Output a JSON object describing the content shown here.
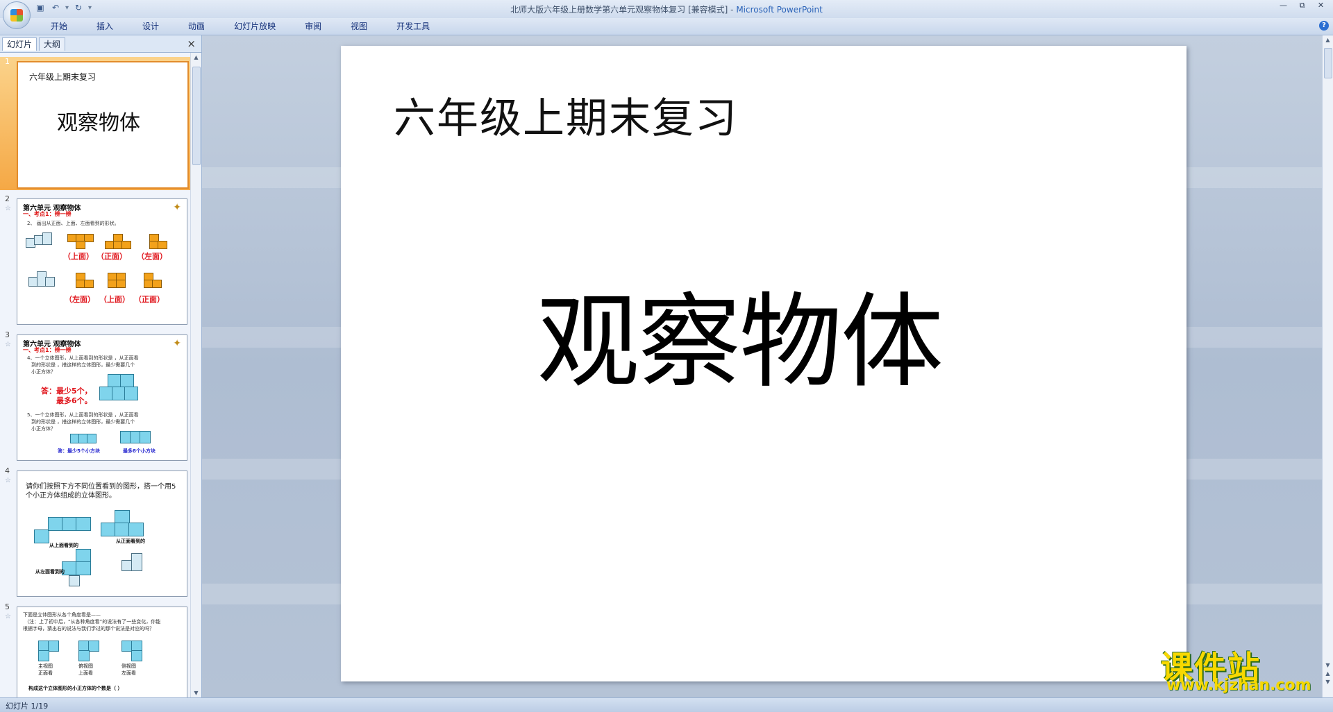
{
  "window": {
    "title_prefix": "北师大版六年级上册数学第六单元观察物体复习 [兼容模式] - ",
    "app_name": "Microsoft PowerPoint"
  },
  "ribbon": {
    "tabs": [
      "开始",
      "插入",
      "设计",
      "动画",
      "幻灯片放映",
      "审阅",
      "视图",
      "开发工具"
    ]
  },
  "panel": {
    "tab_slides": "幻灯片",
    "tab_outline": "大纲",
    "close": "×"
  },
  "thumbnails": [
    {
      "number": "1",
      "subtitle": "六年级上期末复习",
      "title": "观察物体"
    },
    {
      "number": "2",
      "title": "第六单元 观察物体",
      "sub": "一、考点1：辨一辨",
      "line": "2、 画出从正面、上面、左面看到的形状。",
      "labels": [
        "（上面）",
        "（正面）",
        "（左面）",
        "（左面）",
        "（上面）",
        "（正面）"
      ]
    },
    {
      "number": "3",
      "title": "第六单元 观察物体",
      "sub": "一、考点1：辨一辨",
      "line1": "4、一个立体图形，从上面看到的形状是    ，从正面看",
      "line2": "到的形状是    ，搭这样的立体图形，最少需要几个",
      "line3": "小正方体？",
      "answer1": "答：最少5个，",
      "answer2": "最多6个。",
      "line4": "5、一个立体图形，从上面看到的形状是        ，从正面看",
      "line5": "到的形状是    ，搭这样的立体图形，最少需要几个",
      "line6": "小正方体？",
      "cap_left": "答：最少5个小方块",
      "cap_right": "最多8个小方块"
    },
    {
      "number": "4",
      "text": "请你们按照下方不同位置看到的图形，搭一个用5个小正方体组成的立体图形。",
      "cap1": "从上面看到的",
      "cap2": "从正面看到的",
      "cap3": "从左面看到的"
    },
    {
      "number": "5",
      "line1": "下面是立体图形从各个角度看是——",
      "line2": "（注：上了初中后，“从各种角度看”的说法有了一些变化，你能",
      "line3": "根据字母，猜出右的说法与我们学过的那个说法是对应的吗？",
      "cap1": "主视图\n正面看",
      "cap2": "俯视图\n上面看",
      "cap3": "侧视图\n左面看",
      "question": "构成这个立体图形的小正方体的个数是（      ）"
    }
  ],
  "slide": {
    "subtitle": "六年级上期末复习",
    "title": "观察物体"
  },
  "status": {
    "text": "幻灯片 1/19"
  },
  "watermark": {
    "cn": "课件站",
    "url": "www.kjzhan.com"
  },
  "colors": {
    "accent_selection": "#f5a845",
    "ribbon_text": "#15317a",
    "app_name": "#2b63b8"
  }
}
